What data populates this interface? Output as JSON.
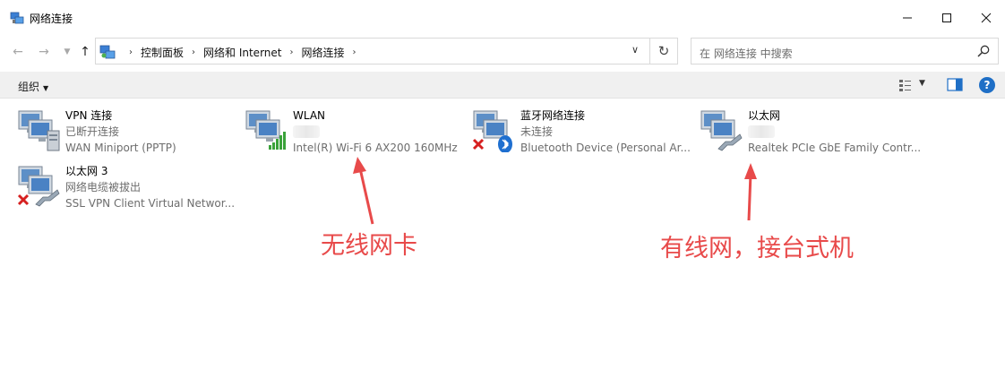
{
  "window": {
    "title": "网络连接"
  },
  "nav": {
    "breadcrumbs": [
      "控制面板",
      "网络和 Internet",
      "网络连接"
    ]
  },
  "search": {
    "placeholder": "在 网络连接 中搜索"
  },
  "toolbar": {
    "organize_label": "组织"
  },
  "connections": [
    {
      "name": "VPN 连接",
      "status": "已断开连接",
      "device": "WAN Miniport (PPTP)",
      "icon": "vpn-network-icon"
    },
    {
      "name": "WLAN",
      "status": "",
      "device": "Intel(R) Wi-Fi 6 AX200 160MHz",
      "icon": "wifi-network-icon"
    },
    {
      "name": "蓝牙网络连接",
      "status": "未连接",
      "device": "Bluetooth Device (Personal Ar...",
      "icon": "bluetooth-network-icon"
    },
    {
      "name": "以太网",
      "status": "",
      "device": "Realtek PCIe GbE Family Contr...",
      "icon": "ethernet-network-icon"
    },
    {
      "name": "以太网 3",
      "status": "网络电缆被拔出",
      "device": "SSL VPN Client Virtual Networ...",
      "icon": "ethernet-network-icon"
    }
  ],
  "annotations": {
    "wireless": "无线网卡",
    "wired": "有线网，接台式机"
  },
  "colors": {
    "annotation": "#e84a4a",
    "accent": "#1f6fc6"
  }
}
